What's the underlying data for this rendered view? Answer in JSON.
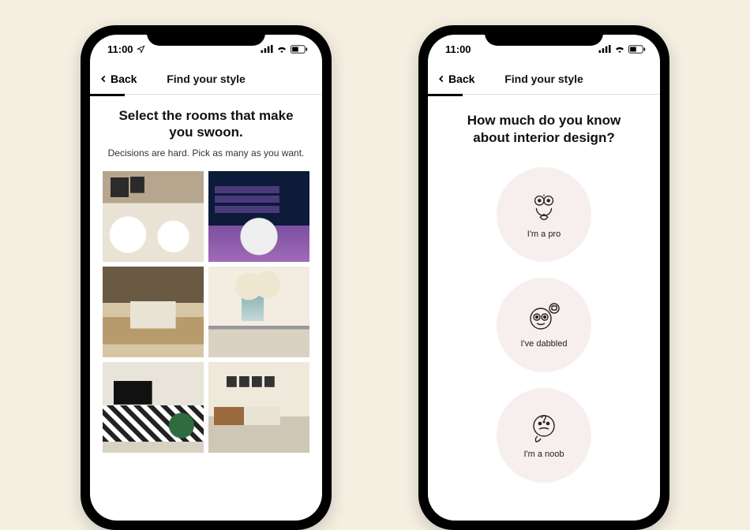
{
  "statusbar": {
    "time": "11:00"
  },
  "nav": {
    "back_label": "Back",
    "title": "Find your style"
  },
  "screen1": {
    "heading": "Select the rooms that make you swoon.",
    "subheading": "Decisions are hard. Pick as many as you want.",
    "rooms": [
      {
        "id": "room-1"
      },
      {
        "id": "room-2"
      },
      {
        "id": "room-3"
      },
      {
        "id": "room-4"
      },
      {
        "id": "room-5"
      },
      {
        "id": "room-6"
      }
    ]
  },
  "screen2": {
    "heading": "How much do you know about interior design?",
    "options": [
      {
        "icon": "pro-face-icon",
        "label": "I'm a pro"
      },
      {
        "icon": "dabbled-face-icon",
        "label": "I've dabbled"
      },
      {
        "icon": "noob-face-icon",
        "label": "I'm a noob"
      }
    ]
  }
}
